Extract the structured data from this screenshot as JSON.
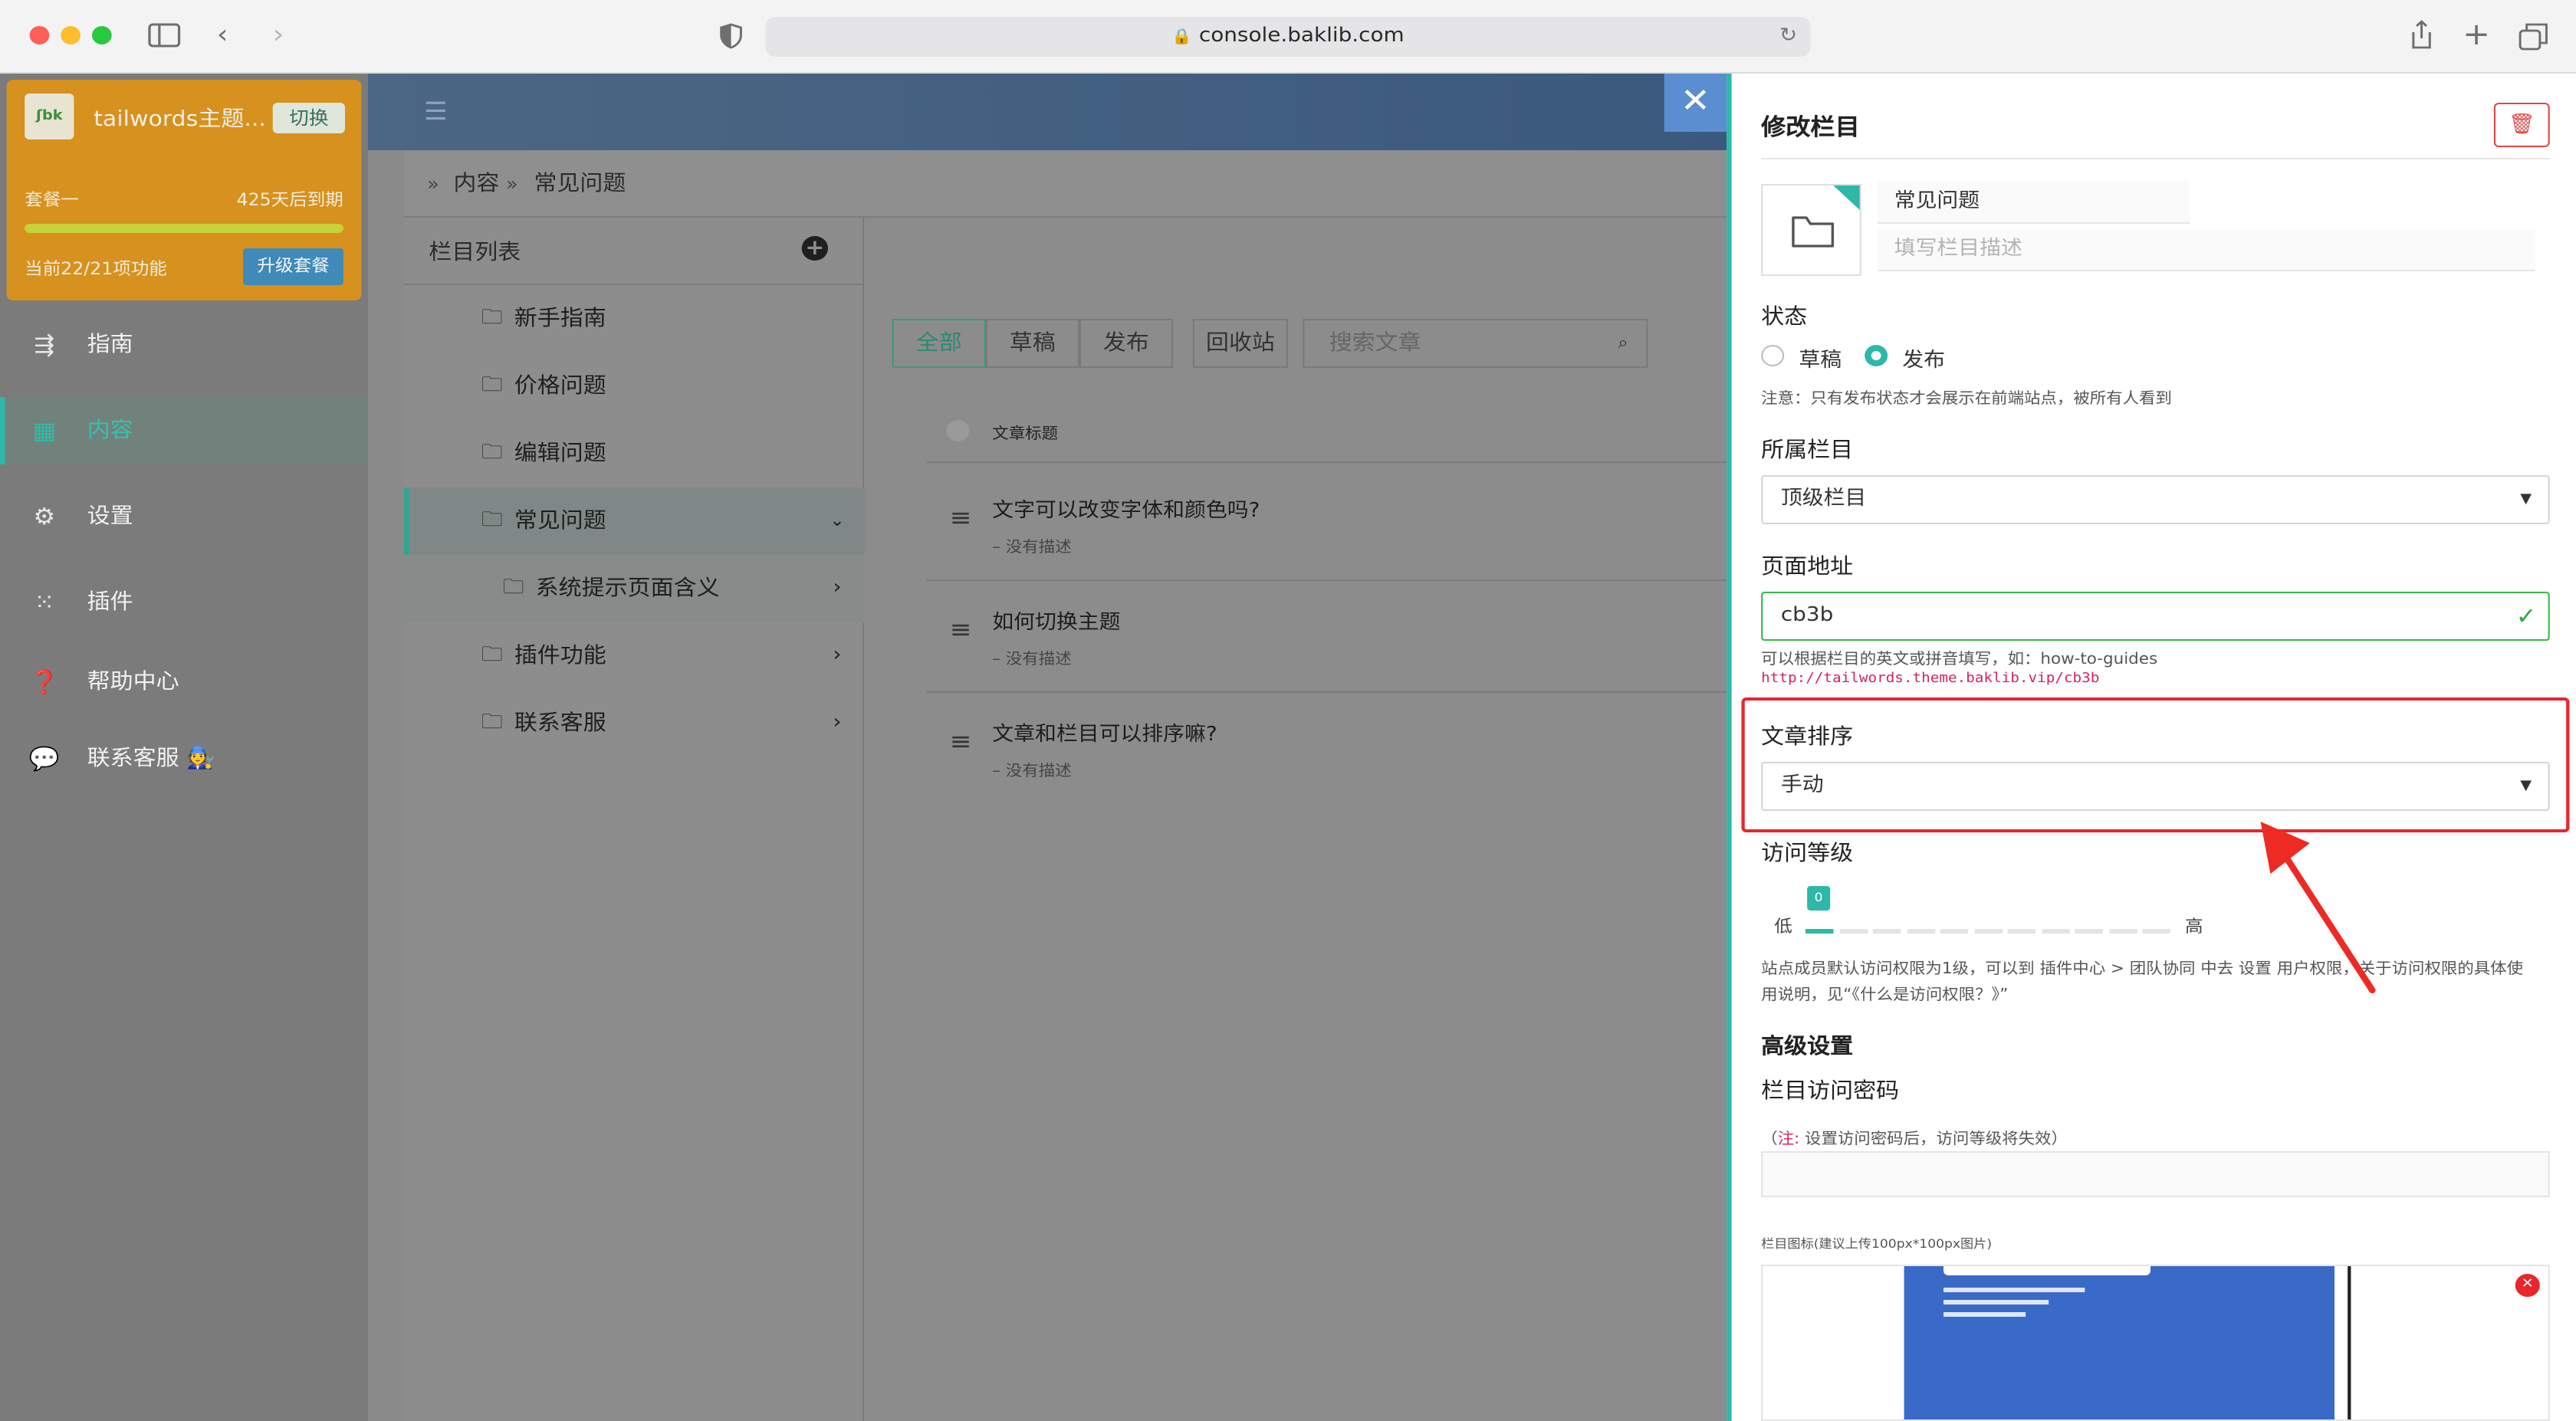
{
  "browser": {
    "url": "console.baklib.com"
  },
  "org": {
    "name": "tailwords主题...",
    "switch_label": "切换",
    "plan": "套餐一",
    "expires": "425天后到期",
    "features": "当前22/21项功能",
    "upgrade_label": "升级套餐",
    "plan_progress": 1.0
  },
  "sidebar": {
    "items": [
      {
        "label": "指南",
        "icon": "guide-icon"
      },
      {
        "label": "内容",
        "icon": "content-icon",
        "active": true
      },
      {
        "label": "设置",
        "icon": "gear-icon"
      },
      {
        "label": "插件",
        "icon": "plugins-icon"
      },
      {
        "label": "帮助中心",
        "icon": "help-icon"
      },
      {
        "label": "联系客服 🧑‍🔧",
        "icon": "chat-icon"
      }
    ]
  },
  "breadcrumb": {
    "items": [
      "内容",
      "常见问题"
    ]
  },
  "columns": {
    "title": "栏目列表",
    "items": [
      {
        "label": "新手指南"
      },
      {
        "label": "价格问题"
      },
      {
        "label": "编辑问题"
      },
      {
        "label": "常见问题",
        "active": true
      },
      {
        "label": "系统提示页面含义"
      },
      {
        "label": "插件功能"
      },
      {
        "label": "联系客服"
      }
    ]
  },
  "filters": {
    "all": "全部",
    "draft": "草稿",
    "published": "发布",
    "trash": "回收站",
    "search_placeholder": "搜索文章"
  },
  "articles": {
    "header": "文章标题",
    "items": [
      {
        "title": "文字可以改变字体和颜色吗?",
        "desc": "– 没有描述"
      },
      {
        "title": "如何切换主题",
        "desc": "– 没有描述"
      },
      {
        "title": "文章和栏目可以排序嘛?",
        "desc": "– 没有描述"
      }
    ]
  },
  "drawer": {
    "title": "修改栏目",
    "name_value": "常见问题",
    "desc_placeholder": "填写栏目描述",
    "status_label": "状态",
    "status_draft": "草稿",
    "status_published": "发布",
    "status_note": "注意：只有发布状态才会展示在前端站点，被所有人看到",
    "parent_label": "所属栏目",
    "parent_value": "顶级栏目",
    "slug_label": "页面地址",
    "slug_value": "cb3b",
    "slug_hint": "可以根据栏目的英文或拼音填写，如：how-to-guides",
    "slug_url": "http://tailwords.theme.baklib.vip/cb3b",
    "sort_label": "文章排序",
    "sort_value": "手动",
    "access_label": "访问等级",
    "access_low": "低",
    "access_high": "高",
    "access_value": 0,
    "access_note_line1": "站点成员默认访问权限为1级，可以到 插件中心 > 团队协同 中去 设置 用户权限，关于访问权限的具体使",
    "access_note_line2": "用说明，见“《什么是访问权限？》”",
    "advanced_label": "高级设置",
    "password_label": "栏目访问密码",
    "password_note_prefix": "（",
    "password_note_mark": "注:",
    "password_note_text": " 设置访问密码后，访问等级将失效）",
    "icon_label": "栏目图标(建议上传100px*100px图片)"
  },
  "colors": {
    "accent": "#2db8a8",
    "highlight": "#e8262c",
    "org_card": "#d6911f",
    "upgrade": "#3f8ab8",
    "close": "#5b8ed1"
  }
}
